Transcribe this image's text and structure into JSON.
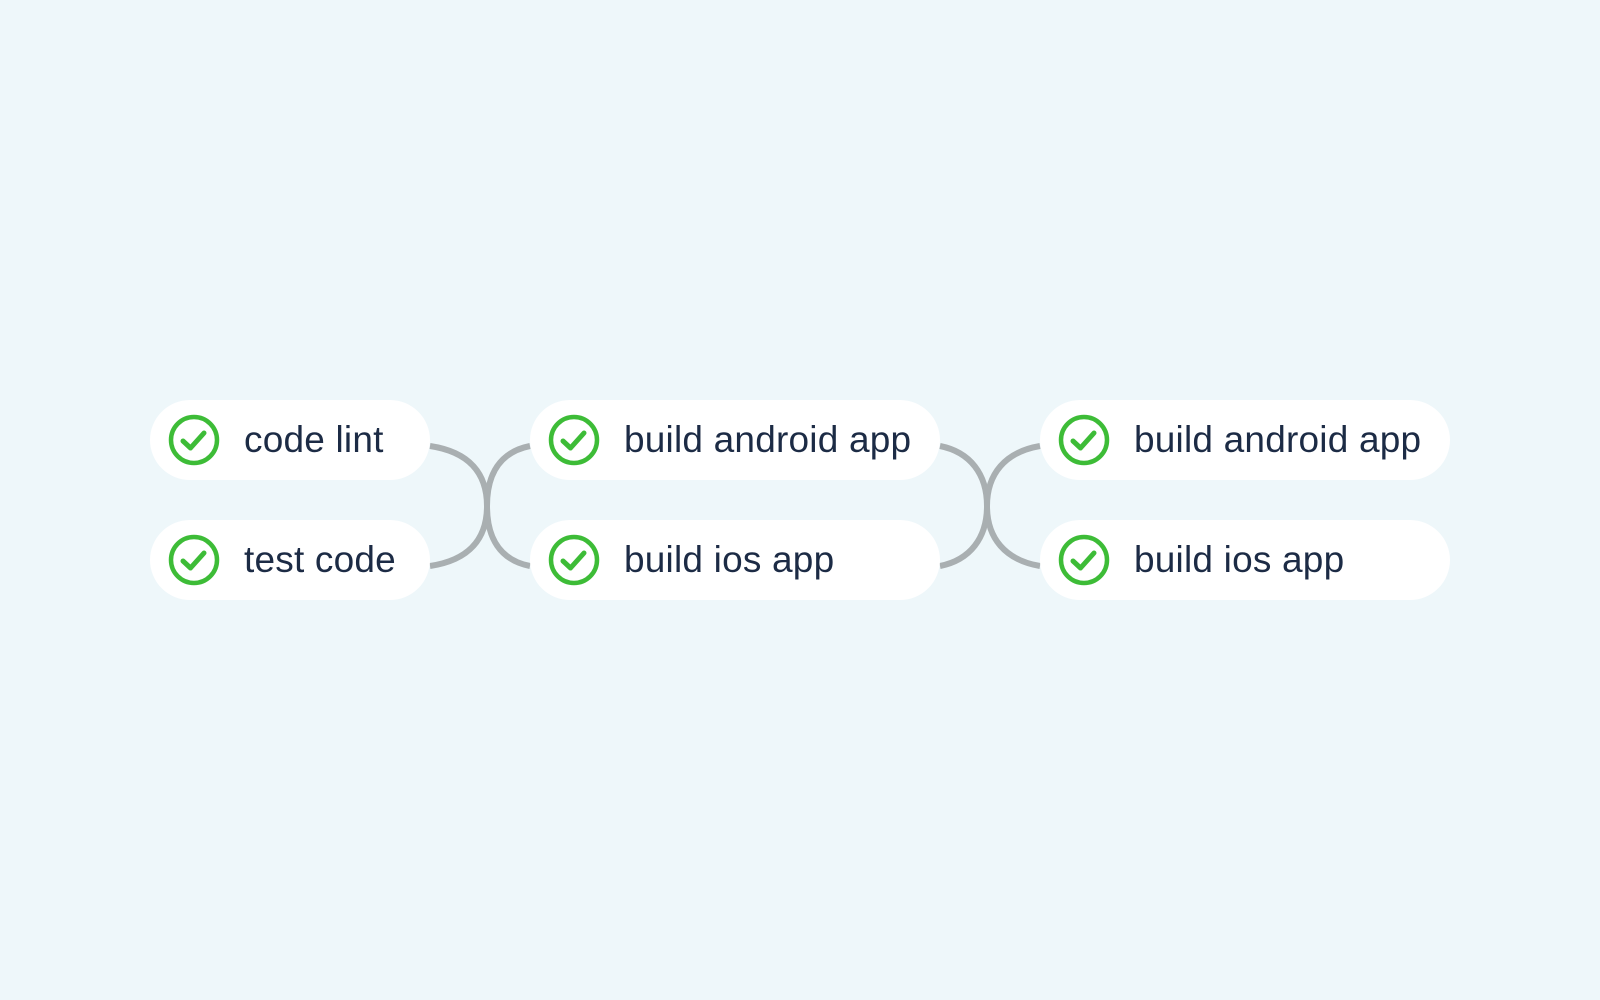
{
  "pipeline": {
    "stages": [
      {
        "jobs": [
          {
            "name": "code lint",
            "status": "success",
            "icon": "check-circle-icon"
          },
          {
            "name": "test code",
            "status": "success",
            "icon": "check-circle-icon"
          }
        ]
      },
      {
        "jobs": [
          {
            "name": "build android app",
            "status": "success",
            "icon": "check-circle-icon"
          },
          {
            "name": "build ios app",
            "status": "success",
            "icon": "check-circle-icon"
          }
        ]
      },
      {
        "jobs": [
          {
            "name": "build android app",
            "status": "success",
            "icon": "check-circle-icon"
          },
          {
            "name": "build ios app",
            "status": "success",
            "icon": "check-circle-icon"
          }
        ]
      }
    ]
  },
  "colors": {
    "background": "#eef7fa",
    "success": "#3dbc37",
    "connector": "#a9afb1",
    "text": "#1c2b45"
  }
}
